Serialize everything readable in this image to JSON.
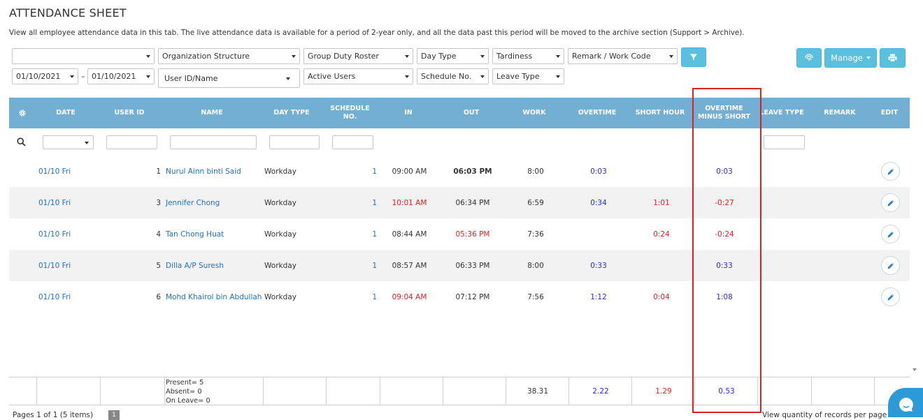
{
  "page": {
    "title": "ATTENDANCE SHEET",
    "description": "View all employee attendance data in this tab. The live attendance data is available for a period of 2-year only, and all the data past this period will be moved to the archive section (Support > Archive)."
  },
  "filters": {
    "row1": [
      "",
      "Organization Structure",
      "Group Duty Roster",
      "Day Type",
      "Tardiness",
      "Remark / Work Code"
    ],
    "date_from": "01/10/2021",
    "date_sep": "–",
    "date_to": "01/10/2021",
    "user": "User ID/Name",
    "row2": [
      "Active Users",
      "Schedule No.",
      "Leave Type"
    ]
  },
  "actions": {
    "manage_label": "Manage"
  },
  "columns": [
    "DATE",
    "USER ID",
    "NAME",
    "DAY TYPE",
    "SCHEDULE NO.",
    "IN",
    "OUT",
    "WORK",
    "OVERTIME",
    "SHORT HOUR",
    "OVERTIME MINUS SHORT",
    "LEAVE TYPE",
    "REMARK",
    "EDIT"
  ],
  "rows": [
    {
      "date": "01/10 Fri",
      "user_id": "1",
      "name": "Nurul Ainn binti Said",
      "day_type": "Workday",
      "schedule": "1",
      "in": "09:00 AM",
      "out": "06:03 PM",
      "work": "8:00",
      "overtime": "0:03",
      "short": "",
      "ot_minus_short": "0:03"
    },
    {
      "date": "01/10 Fri",
      "user_id": "3",
      "name": "Jennifer Chong",
      "day_type": "Workday",
      "schedule": "1",
      "in": "10:01 AM",
      "out": "06:34 PM",
      "work": "6:59",
      "overtime": "0:34",
      "short": "1:01",
      "ot_minus_short": "-0:27"
    },
    {
      "date": "01/10 Fri",
      "user_id": "4",
      "name": "Tan Chong Huat",
      "day_type": "Workday",
      "schedule": "1",
      "in": "08:44 AM",
      "out": "05:36 PM",
      "work": "7:36",
      "overtime": "",
      "short": "0:24",
      "ot_minus_short": "-0:24"
    },
    {
      "date": "01/10 Fri",
      "user_id": "5",
      "name": "Dilla A/P Suresh",
      "day_type": "Workday",
      "schedule": "1",
      "in": "08:57 AM",
      "out": "06:33 PM",
      "work": "8:00",
      "overtime": "0:33",
      "short": "",
      "ot_minus_short": "0:33"
    },
    {
      "date": "01/10 Fri",
      "user_id": "6",
      "name": "Mohd Khairol bin Abdullah",
      "day_type": "Workday",
      "schedule": "1",
      "in": "09:04 AM",
      "out": "07:12 PM",
      "work": "7:56",
      "overtime": "1:12",
      "short": "0:04",
      "ot_minus_short": "1:08"
    }
  ],
  "summary": {
    "present": "Present= 5",
    "absent": "Absent= 0",
    "on_leave": "On Leave= 0",
    "work": "38.31",
    "overtime": "2.22",
    "short": "1.29",
    "ot_minus_short": "0.53"
  },
  "pager": {
    "text": "Pages 1 of 1 (5 items)",
    "current": "1",
    "per_page": "View quantity of records per page"
  }
}
